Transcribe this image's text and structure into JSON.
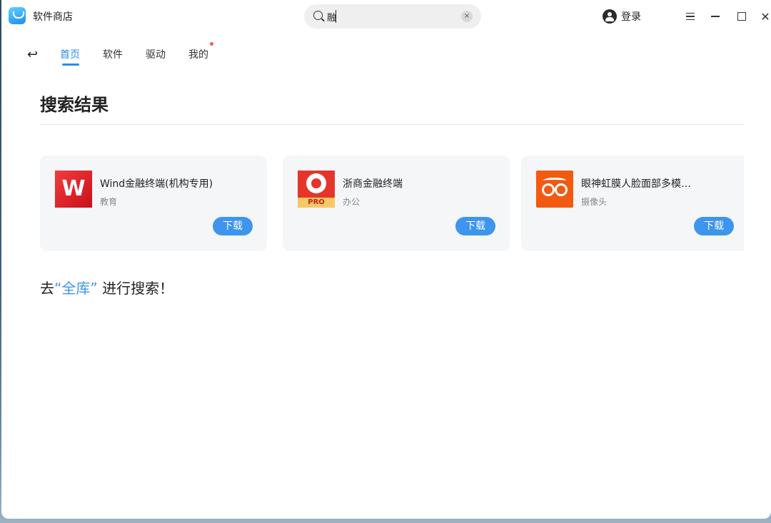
{
  "app": {
    "title": "软件商店"
  },
  "search": {
    "value": "融",
    "clear_label": "×"
  },
  "user": {
    "login_label": "登录"
  },
  "window_controls": {
    "close": "✕"
  },
  "nav": {
    "back": "↩",
    "items": [
      {
        "label": "首页",
        "active": true
      },
      {
        "label": "软件",
        "active": false
      },
      {
        "label": "驱动",
        "active": false
      },
      {
        "label": "我的",
        "active": false,
        "badge": true
      }
    ]
  },
  "results": {
    "heading": "搜索结果",
    "items": [
      {
        "name": "Wind金融终端(机构专用)",
        "category": "教育",
        "button": "下载",
        "icon_text": "W"
      },
      {
        "name": "浙商金融终端",
        "category": "办公",
        "button": "下载",
        "icon_text": "PRO"
      },
      {
        "name": "眼神虹膜人脸面部多模…",
        "category": "摄像头",
        "button": "下载"
      }
    ]
  },
  "footer": {
    "prefix": "去",
    "link": "“全库”",
    "suffix": "进行搜索！"
  },
  "colors": {
    "accent": "#3d95ee",
    "badge": "#f25a5a"
  }
}
